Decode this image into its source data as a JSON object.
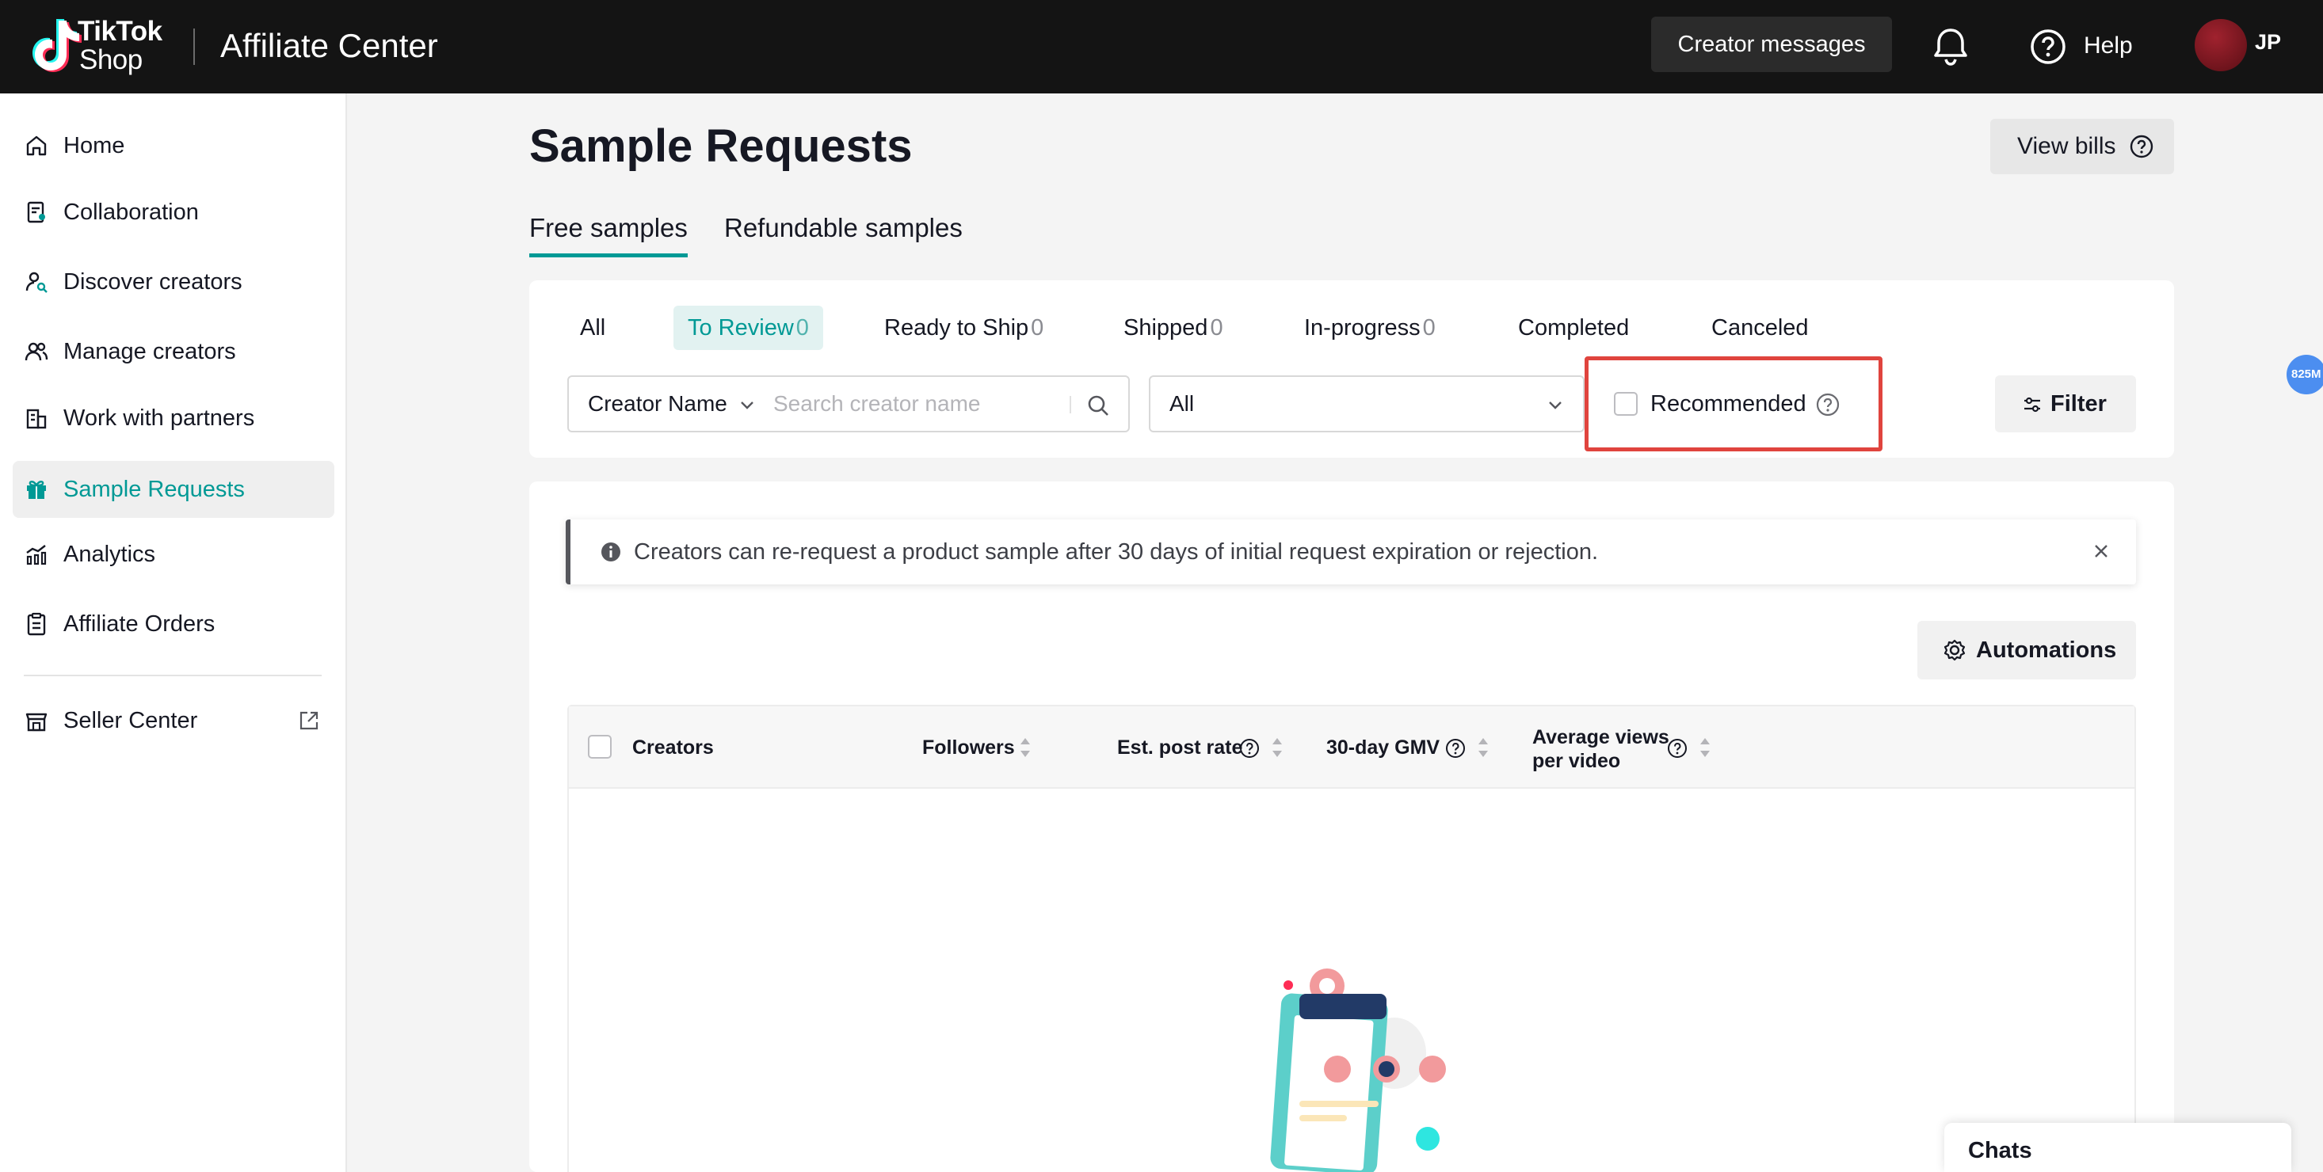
{
  "header": {
    "brand_line1": "TikTok",
    "brand_line2": "Shop",
    "app_title": "Affiliate Center",
    "creator_messages": "Creator messages",
    "help": "Help",
    "avatar_initials": "JP"
  },
  "sidebar": {
    "items": [
      {
        "label": "Home",
        "icon": "home-icon"
      },
      {
        "label": "Collaboration",
        "icon": "collaboration-icon"
      },
      {
        "label": "Discover creators",
        "icon": "discover-creators-icon"
      },
      {
        "label": "Manage creators",
        "icon": "manage-creators-icon"
      },
      {
        "label": "Work with partners",
        "icon": "partners-icon"
      },
      {
        "label": "Sample Requests",
        "icon": "gift-icon",
        "active": true
      },
      {
        "label": "Analytics",
        "icon": "analytics-icon"
      },
      {
        "label": "Affiliate Orders",
        "icon": "clipboard-icon"
      },
      {
        "label": "Seller Center",
        "icon": "store-icon"
      }
    ]
  },
  "page": {
    "title": "Sample Requests",
    "view_bills": "View bills",
    "tabs": [
      "Free samples",
      "Refundable samples"
    ],
    "selected_tab": "Free samples"
  },
  "status_tabs": [
    {
      "label": "All",
      "count": ""
    },
    {
      "label": "To Review",
      "count": "0"
    },
    {
      "label": "Ready to Ship",
      "count": "0"
    },
    {
      "label": "Shipped",
      "count": "0"
    },
    {
      "label": "In-progress",
      "count": "0"
    },
    {
      "label": "Completed",
      "count": ""
    },
    {
      "label": "Canceled",
      "count": ""
    }
  ],
  "filters": {
    "search_field": "Creator Name",
    "search_placeholder": "Search creator name",
    "status_value": "All",
    "recommended_label": "Recommended",
    "filter_button": "Filter"
  },
  "floating_badge": "825M",
  "notice": {
    "text": "Creators can re-request a product sample after 30 days of initial request expiration or rejection."
  },
  "automations_button": "Automations",
  "table": {
    "columns": [
      "Creators",
      "Followers",
      "Est. post rate",
      "30-day GMV",
      "Average views",
      "per video"
    ]
  },
  "chats_label": "Chats",
  "colors": {
    "accent": "#009995",
    "header_bg": "#141414",
    "highlight_border": "#e0443e"
  }
}
